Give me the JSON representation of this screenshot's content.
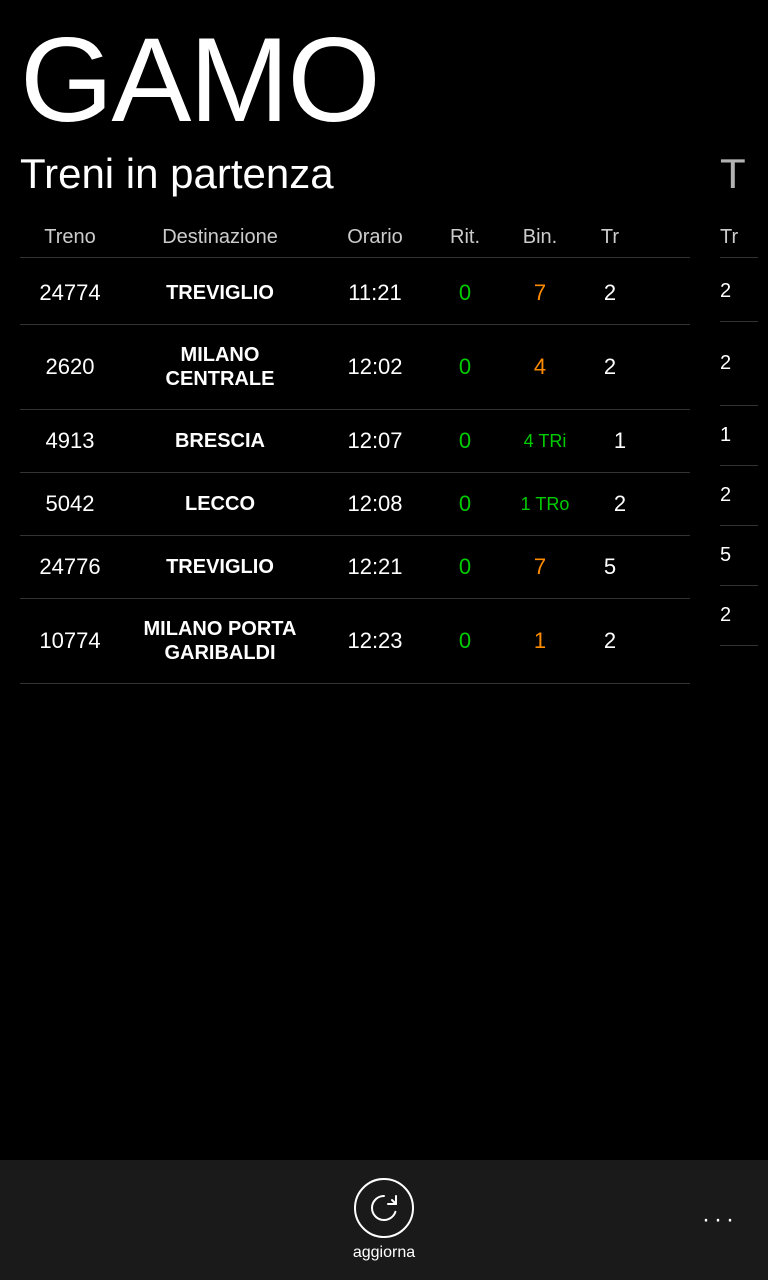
{
  "app": {
    "city_title": "GAMO",
    "section_departures": "Treni in partenza",
    "section_arrivals": "T",
    "colors": {
      "bg": "#000000",
      "green": "#00cc00",
      "orange": "#ff8c00",
      "white": "#ffffff"
    }
  },
  "table": {
    "headers": {
      "treno": "Treno",
      "destinazione": "Destinazione",
      "orario": "Orario",
      "rit": "Rit.",
      "bin": "Bin.",
      "tr": "Tr"
    }
  },
  "departures": [
    {
      "treno": "24774",
      "destinazione": "TREVIGLIO",
      "orario": "11:21",
      "rit": "0",
      "bin": "7",
      "tr": "2",
      "rit_color": "green",
      "bin_color": "orange",
      "tr_color": "white"
    },
    {
      "treno": "2620",
      "destinazione": "MILANO\nCENTRALE",
      "orario": "12:02",
      "rit": "0",
      "bin": "4",
      "tr": "2",
      "rit_color": "green",
      "bin_color": "orange",
      "tr_color": "white"
    },
    {
      "treno": "4913",
      "destinazione": "BRESCIA",
      "orario": "12:07",
      "rit": "0",
      "bin": "4 TRi",
      "tr": "1",
      "rit_color": "green",
      "bin_color": "green",
      "tr_color": "white"
    },
    {
      "treno": "5042",
      "destinazione": "LECCO",
      "orario": "12:08",
      "rit": "0",
      "bin": "1 TRo",
      "tr": "2",
      "rit_color": "green",
      "bin_color": "green",
      "tr_color": "white"
    },
    {
      "treno": "24776",
      "destinazione": "TREVIGLIO",
      "orario": "12:21",
      "rit": "0",
      "bin": "7",
      "tr": "5",
      "rit_color": "green",
      "bin_color": "orange",
      "tr_color": "white"
    },
    {
      "treno": "10774",
      "destinazione": "MILANO PORTA\nGARIBALDI",
      "orario": "12:23",
      "rit": "0",
      "bin": "1",
      "tr": "2",
      "rit_color": "green",
      "bin_color": "orange",
      "tr_color": "white"
    }
  ],
  "toolbar": {
    "refresh_label": "aggiorna",
    "more_dots": "···"
  }
}
